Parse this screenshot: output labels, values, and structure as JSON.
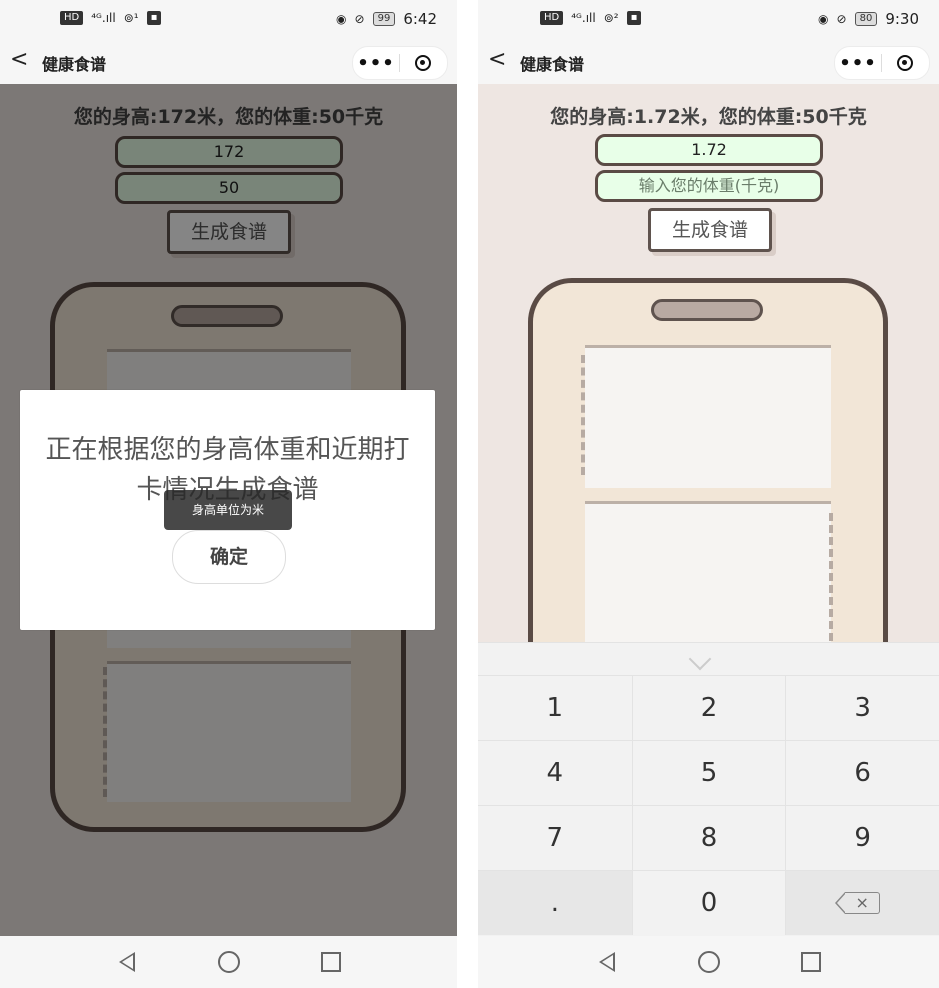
{
  "left": {
    "status": {
      "network": "4G",
      "signal": "4G.ill",
      "wifi": "wifi",
      "battery": "99",
      "time": "6:42"
    },
    "nav": {
      "back": "<",
      "title": "健康食谱",
      "more": "•••"
    },
    "info": "您的身高:172米，您的体重:50千克",
    "height_value": "172",
    "weight_value": "50",
    "generate_label": "生成食谱",
    "modal": {
      "message": "正在根据您的身高体重和近期打卡情况生成食谱",
      "confirm": "确定"
    },
    "toast": "身高单位为米"
  },
  "right": {
    "status": {
      "network": "4G",
      "battery": "80",
      "time": "9:30"
    },
    "nav": {
      "back": "<",
      "title": "健康食谱",
      "more": "•••"
    },
    "info": "您的身高:1.72米，您的体重:50千克",
    "height_value": "1.72",
    "weight_placeholder": "输入您的体重(千克)",
    "generate_label": "生成食谱",
    "keyboard": {
      "keys": [
        "1",
        "2",
        "3",
        "4",
        "5",
        "6",
        "7",
        "8",
        "9",
        ".",
        "0",
        "×"
      ]
    }
  }
}
